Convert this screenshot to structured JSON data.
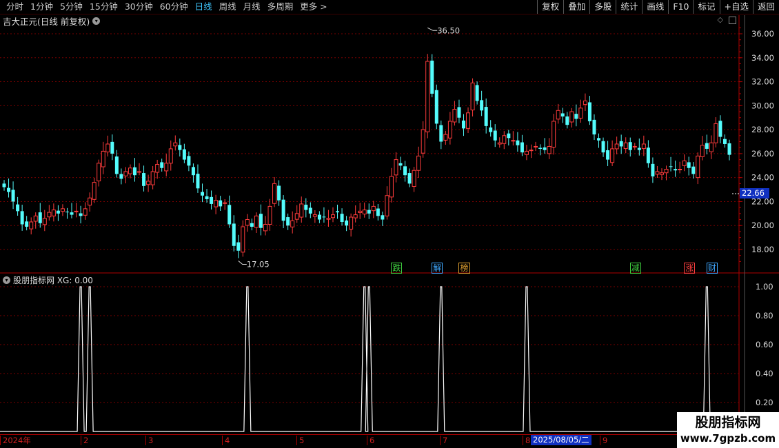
{
  "toolbar": {
    "periods": [
      "分时",
      "1分钟",
      "5分钟",
      "15分钟",
      "30分钟",
      "60分钟",
      "日线",
      "周线",
      "月线",
      "多周期",
      "更多 >"
    ],
    "active_period": "日线",
    "right_buttons": [
      "复权",
      "叠加",
      "多股",
      "统计",
      "画线",
      "F10",
      "标记",
      "+自选",
      "返回"
    ]
  },
  "main_chart": {
    "title": "吉大正元(日线 前复权)",
    "yticks": [
      "36.00",
      "34.00",
      "32.00",
      "30.00",
      "28.00",
      "26.00",
      "24.00",
      "22.00",
      "20.00",
      "18.00"
    ],
    "current_price": "22.66",
    "high_label": "36.50",
    "low_label": "17.05",
    "signals": [
      {
        "text": "跌",
        "color": "#3fd03f"
      },
      {
        "text": "解",
        "color": "#3fa8ff"
      },
      {
        "text": "榜",
        "color": "#e0a030"
      },
      {
        "text": "减",
        "color": "#3fd03f"
      },
      {
        "text": "涨",
        "color": "#ff4040"
      },
      {
        "text": "财",
        "color": "#3fa8ff"
      }
    ]
  },
  "sub_chart": {
    "title": "股朋指标网 XG: 0.00",
    "yticks": [
      "1.00",
      "0.80",
      "0.60",
      "0.40",
      "0.20"
    ]
  },
  "xaxis": {
    "labels": [
      "2024年",
      "2",
      "3",
      "4",
      "5",
      "6",
      "7",
      "8",
      "9"
    ],
    "selected_date": "2025/08/05/二"
  },
  "watermark": {
    "line1": "股朋指标网",
    "line2": "www.7gpzb.com"
  },
  "colors": {
    "up": "#ff3c3c",
    "down": "#54fcfc",
    "grid": "#7a0000",
    "axis": "#b00000"
  },
  "chart_data": [
    {
      "type": "candlestick",
      "title": "吉大正元(日线 前复权)",
      "ylim": [
        16.5,
        37.0
      ],
      "close_series": [
        23.2,
        22.8,
        22.0,
        21.2,
        20.1,
        19.9,
        20.3,
        20.8,
        20.2,
        20.6,
        21.1,
        21.3,
        21.0,
        21.4,
        21.1,
        20.9,
        21.2,
        20.8,
        21.4,
        22.3,
        23.6,
        25.2,
        26.2,
        26.8,
        26.0,
        24.3,
        23.9,
        24.5,
        24.8,
        24.2,
        24.5,
        23.3,
        23.7,
        24.5,
        25.1,
        24.8,
        25.2,
        26.4,
        26.9,
        26.3,
        25.5,
        25.0,
        24.2,
        23.1,
        22.5,
        22.2,
        21.8,
        22.1,
        21.6,
        21.9,
        20.1,
        18.3,
        17.9,
        19.9,
        20.5,
        19.9,
        20.8,
        19.8,
        20.1,
        21.6,
        23.5,
        22.1,
        20.4,
        20.0,
        20.4,
        21.0,
        21.8,
        21.3,
        21.0,
        20.9,
        20.5,
        20.7,
        20.6,
        20.9,
        21.1,
        20.3,
        20.0,
        20.7,
        20.9,
        21.2,
        21.3,
        21.0,
        21.6,
        20.8,
        20.5,
        22.5,
        24.1,
        25.5,
        25.0,
        24.2,
        23.5,
        24.6,
        25.8,
        28.0,
        33.7,
        31.0,
        28.5,
        27.0,
        27.6,
        28.7,
        29.7,
        29.0,
        28.1,
        29.4,
        31.9,
        30.4,
        29.6,
        28.3,
        27.8,
        27.1,
        26.9,
        27.5,
        27.3,
        27.1,
        26.7,
        26.1,
        26.2,
        26.3,
        26.6,
        26.4,
        26.3,
        26.6,
        28.7,
        29.6,
        29.1,
        28.4,
        29.5,
        28.9,
        29.8,
        30.4,
        28.7,
        27.6,
        27.1,
        26.1,
        25.5,
        26.4,
        26.8,
        26.6,
        26.9,
        26.3,
        26.6,
        26.3,
        26.8,
        25.2,
        24.1,
        24.5,
        24.4,
        24.7,
        24.9,
        24.6,
        24.7,
        25.4,
        24.8,
        24.3,
        25.8,
        26.7,
        26.4,
        26.9,
        28.5,
        27.4,
        26.8,
        25.9
      ]
    },
    {
      "type": "line",
      "title": "股朋指标网 XG: 0.00",
      "series": [
        {
          "name": "XG",
          "peaks_at_index": [
            17,
            19,
            54,
            80,
            81,
            97,
            116,
            156
          ]
        }
      ],
      "ylim": [
        0,
        1.0
      ]
    }
  ]
}
